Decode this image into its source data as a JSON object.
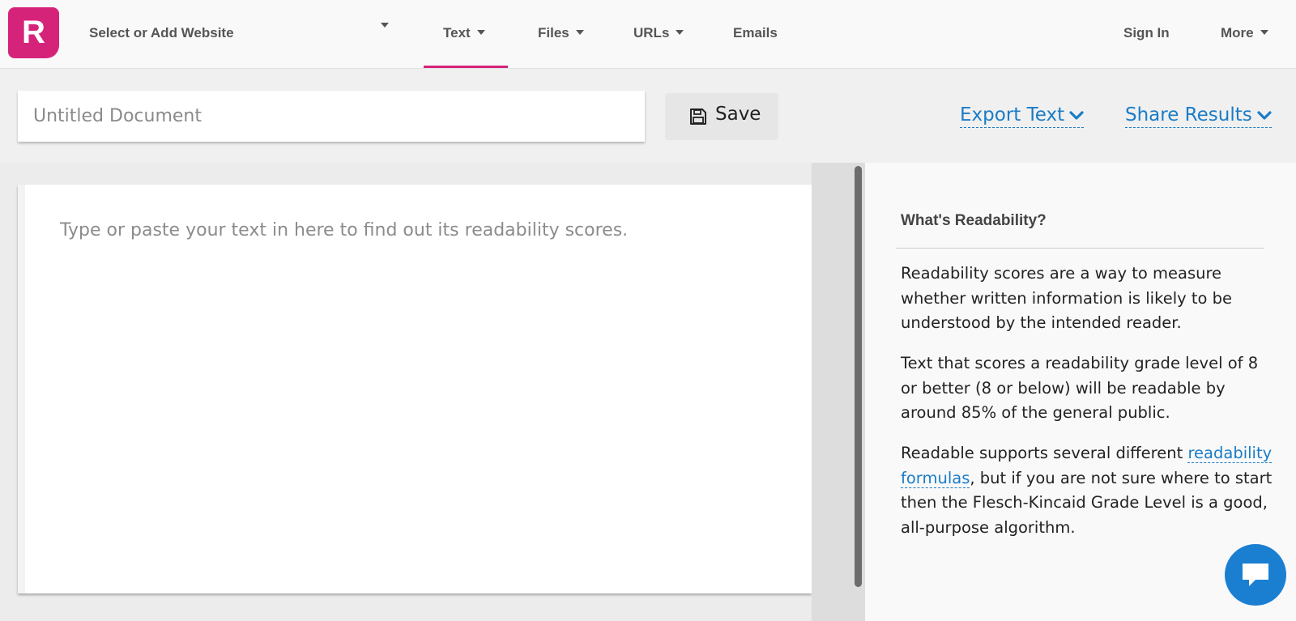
{
  "header": {
    "logo_letter": "R",
    "site_select_label": "Select or Add Website",
    "nav": [
      {
        "label": "Text",
        "has_caret": true,
        "active": true
      },
      {
        "label": "Files",
        "has_caret": true
      },
      {
        "label": "URLs",
        "has_caret": true
      },
      {
        "label": "Emails",
        "has_caret": false
      }
    ],
    "sign_in_label": "Sign In",
    "more_label": "More"
  },
  "toolbar": {
    "title_placeholder": "Untitled Document",
    "title_value": "",
    "save_label": "Save",
    "export_label": "Export Text",
    "share_label": "Share Results"
  },
  "editor": {
    "placeholder": "Type or paste your text in here to find out its readability scores."
  },
  "sidebar": {
    "heading": "What's Readability?",
    "p1": "Readability scores are a way to measure whether written information is likely to be understood by the intended reader.",
    "p2": "Text that scores a readability grade level of 8 or better (8 or below) will be readable by around 85% of the general public.",
    "p3_before": "Readable supports several different ",
    "p3_link": "readability formulas",
    "p3_after": ", but if you are not sure where to start then the Flesch-Kincaid Grade Level is a good, all-purpose algorithm."
  },
  "colors": {
    "brand": "#d6237a",
    "link": "#1a7cc7",
    "chat": "#1b7fd1"
  },
  "icons": [
    "caret-down-icon",
    "floppy-disk-icon",
    "chevron-down-icon",
    "chat-bubble-icon"
  ]
}
